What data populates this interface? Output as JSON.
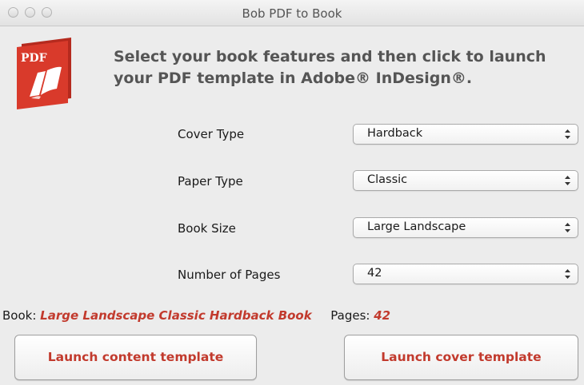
{
  "window": {
    "title": "Bob PDF to Book"
  },
  "logo": {
    "label": "PDF",
    "color": "#d93a2b"
  },
  "headline": "Select your book features and then click to launch your PDF template in Adobe® InDesign®.",
  "form": {
    "cover_type": {
      "label": "Cover Type",
      "value": "Hardback"
    },
    "paper_type": {
      "label": "Paper Type",
      "value": "Classic"
    },
    "book_size": {
      "label": "Book Size",
      "value": "Large Landscape"
    },
    "number_of_pages": {
      "label": "Number of Pages",
      "value": "42"
    }
  },
  "summary": {
    "book_label": "Book:",
    "book_value": "Large Landscape Classic Hardback Book",
    "pages_label": "Pages:",
    "pages_value": "42"
  },
  "buttons": {
    "content": "Launch content template",
    "cover": "Launch cover template"
  },
  "colors": {
    "accent": "#c23a2d",
    "headline": "#555555"
  }
}
